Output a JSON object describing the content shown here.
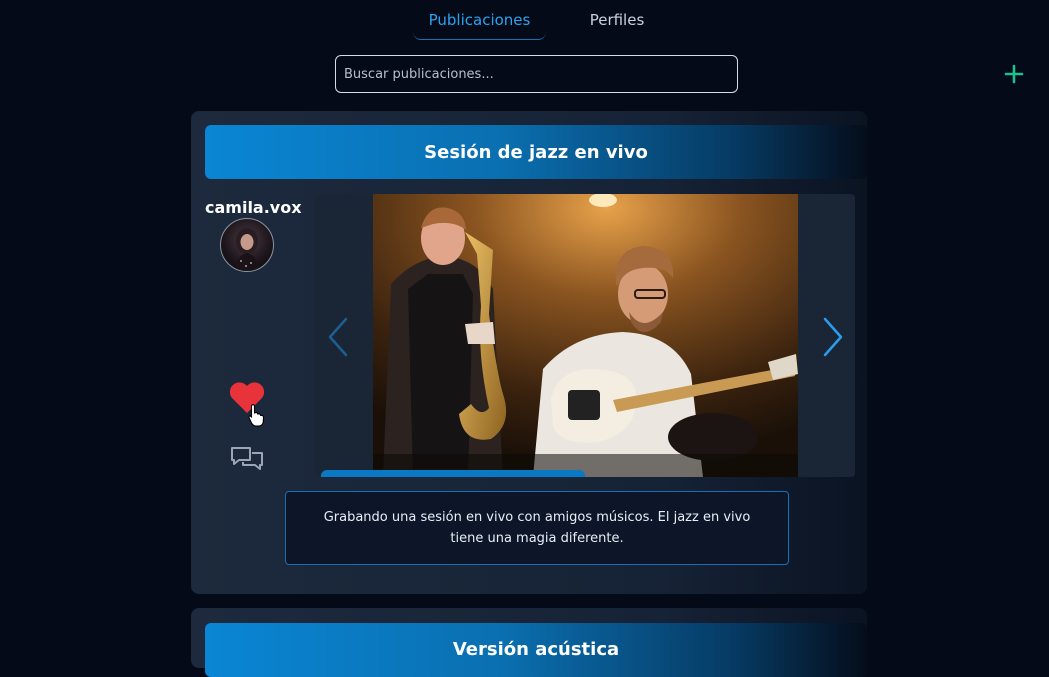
{
  "tabs": [
    {
      "label": "Publicaciones",
      "active": true
    },
    {
      "label": "Perfiles",
      "active": false
    }
  ],
  "search": {
    "placeholder": "Buscar publicaciones..."
  },
  "add_button": {
    "icon": "plus-icon",
    "color": "#1fbf8f"
  },
  "posts": [
    {
      "title": "Sesión de jazz en vivo",
      "username": "camila.vox",
      "liked": true,
      "image_count": 2,
      "active_image": 1,
      "caption": "Grabando una sesión en vivo con amigos músicos. El jazz en vivo tiene una magia diferente."
    },
    {
      "title": "Versión acústica"
    }
  ],
  "colors": {
    "accent": "#2aa3ef",
    "heart": "#e8333a",
    "background": "#050a18"
  }
}
